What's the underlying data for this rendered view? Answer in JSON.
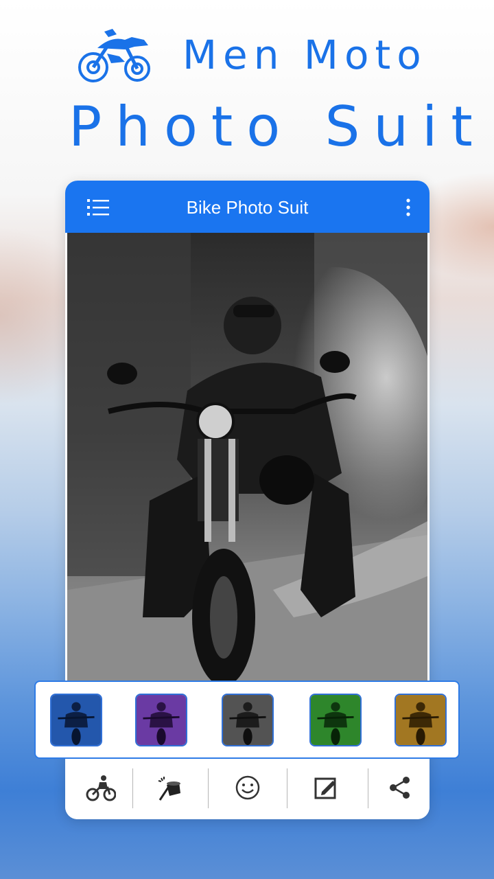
{
  "header": {
    "logo_icon": "motorbike-logo-icon",
    "title_line1": "Men Moto",
    "title_line2": "Photo Suit",
    "brand_color": "#1a72e8"
  },
  "app": {
    "title": "Bike Photo Suit",
    "menu_icon": "list-menu-icon",
    "more_icon": "more-vertical-icon",
    "accent_color": "#1a75f0"
  },
  "main_photo": {
    "icon": "motorbike-rider-photo",
    "filter": "grayscale"
  },
  "effects": [
    {
      "name": "blue",
      "color": "#2f6fd6"
    },
    {
      "name": "purple",
      "color": "#8a4fd0"
    },
    {
      "name": "gray",
      "color": "#6b6b6b"
    },
    {
      "name": "green",
      "color": "#3fae3a"
    },
    {
      "name": "sepia",
      "color": "#c9962f"
    }
  ],
  "toolbar": [
    {
      "icon": "bike-suit-icon",
      "action": "suits"
    },
    {
      "icon": "magic-hat-icon",
      "action": "effects"
    },
    {
      "icon": "smiley-sticker-icon",
      "action": "stickers"
    },
    {
      "icon": "edit-text-icon",
      "action": "text"
    },
    {
      "icon": "share-icon",
      "action": "share"
    }
  ]
}
